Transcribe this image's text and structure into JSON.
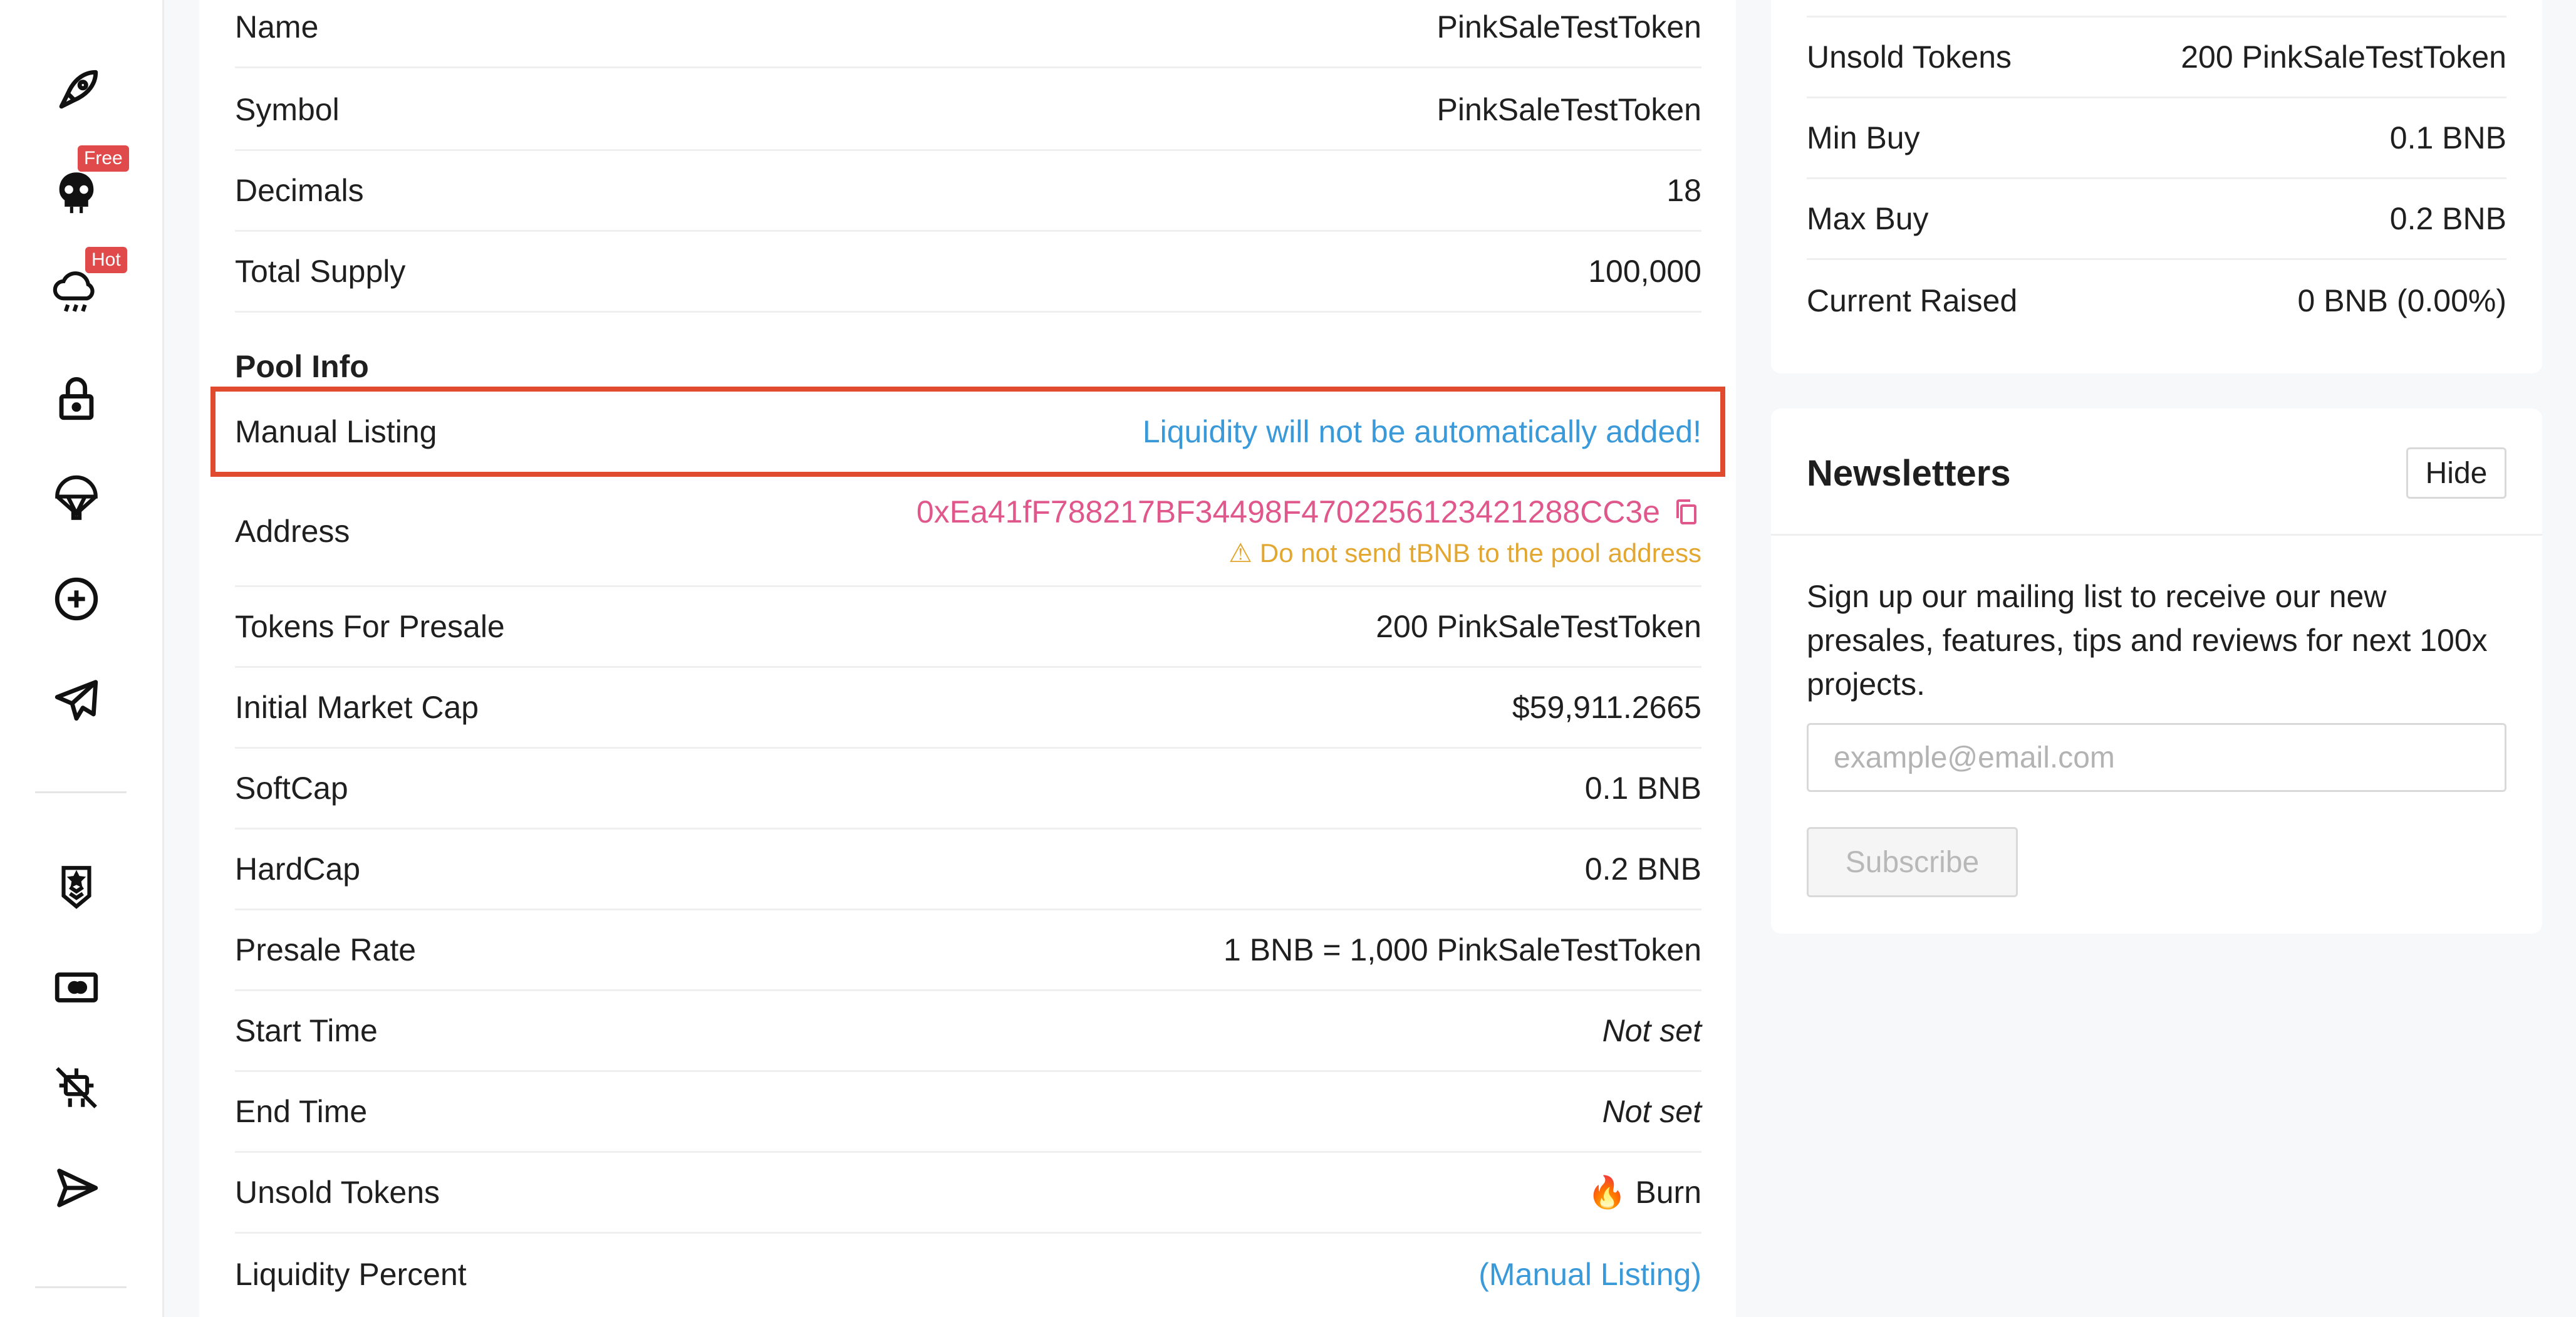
{
  "sidebar": {
    "icons": [
      {
        "name": "rocket-icon"
      },
      {
        "name": "skull-icon",
        "badge": "Free"
      },
      {
        "name": "cloud-rain-icon",
        "badge": "Hot"
      },
      {
        "name": "lock-icon"
      },
      {
        "name": "parachute-icon"
      },
      {
        "name": "plus-circle-icon"
      },
      {
        "name": "telegram-icon"
      },
      {
        "name": "shield-rank-icon"
      },
      {
        "name": "ticket-icon"
      },
      {
        "name": "no-bot-icon"
      },
      {
        "name": "send-icon"
      }
    ],
    "badges": {
      "free": "Free",
      "hot": "Hot"
    }
  },
  "token_info": {
    "name_label": "Name",
    "name_value": "PinkSaleTestToken",
    "symbol_label": "Symbol",
    "symbol_value": "PinkSaleTestToken",
    "decimals_label": "Decimals",
    "decimals_value": "18",
    "supply_label": "Total Supply",
    "supply_value": "100,000"
  },
  "pool_info": {
    "title": "Pool Info",
    "manual_label": "Manual Listing",
    "manual_value": "Liquidity will not be automatically added!",
    "address_label": "Address",
    "address_value": "0xEa41fF788217BF34498F470225612342128 8CC3e",
    "address_warning": "Do not send tBNB to the pool address",
    "presale_tokens_label": "Tokens For Presale",
    "presale_tokens_value": "200 PinkSaleTestToken",
    "market_cap_label": "Initial Market Cap",
    "market_cap_value": "$59,911.2665",
    "softcap_label": "SoftCap",
    "softcap_value": "0.1 BNB",
    "hardcap_label": "HardCap",
    "hardcap_value": "0.2 BNB",
    "rate_label": "Presale Rate",
    "rate_value": "1 BNB = 1,000 PinkSaleTestToken",
    "start_label": "Start Time",
    "start_value": "Not set",
    "end_label": "End Time",
    "end_value": "Not set",
    "unsold_label": "Unsold Tokens",
    "unsold_value": "🔥 Burn",
    "liquidity_label": "Liquidity Percent",
    "liquidity_value": "(Manual Listing)"
  },
  "status": {
    "unsold_label": "Unsold Tokens",
    "unsold_value": "200 PinkSaleTestToken",
    "min_label": "Min Buy",
    "min_value": "0.1 BNB",
    "max_label": "Max Buy",
    "max_value": "0.2 BNB",
    "raised_label": "Current Raised",
    "raised_value": "0 BNB (0.00%)"
  },
  "newsletter": {
    "title": "Newsletters",
    "hide_label": "Hide",
    "text": "Sign up our mailing list to receive our new presales, features, tips and reviews for next 100x projects.",
    "email_placeholder": "example@email.com",
    "subscribe_label": "Subscribe"
  },
  "colors": {
    "accent_blue": "#3a9ad9",
    "address_pink": "#e0578c",
    "warning_yellow": "#e3a72f",
    "highlight_red": "#e04a2f",
    "badge_red": "#e04a4a"
  }
}
